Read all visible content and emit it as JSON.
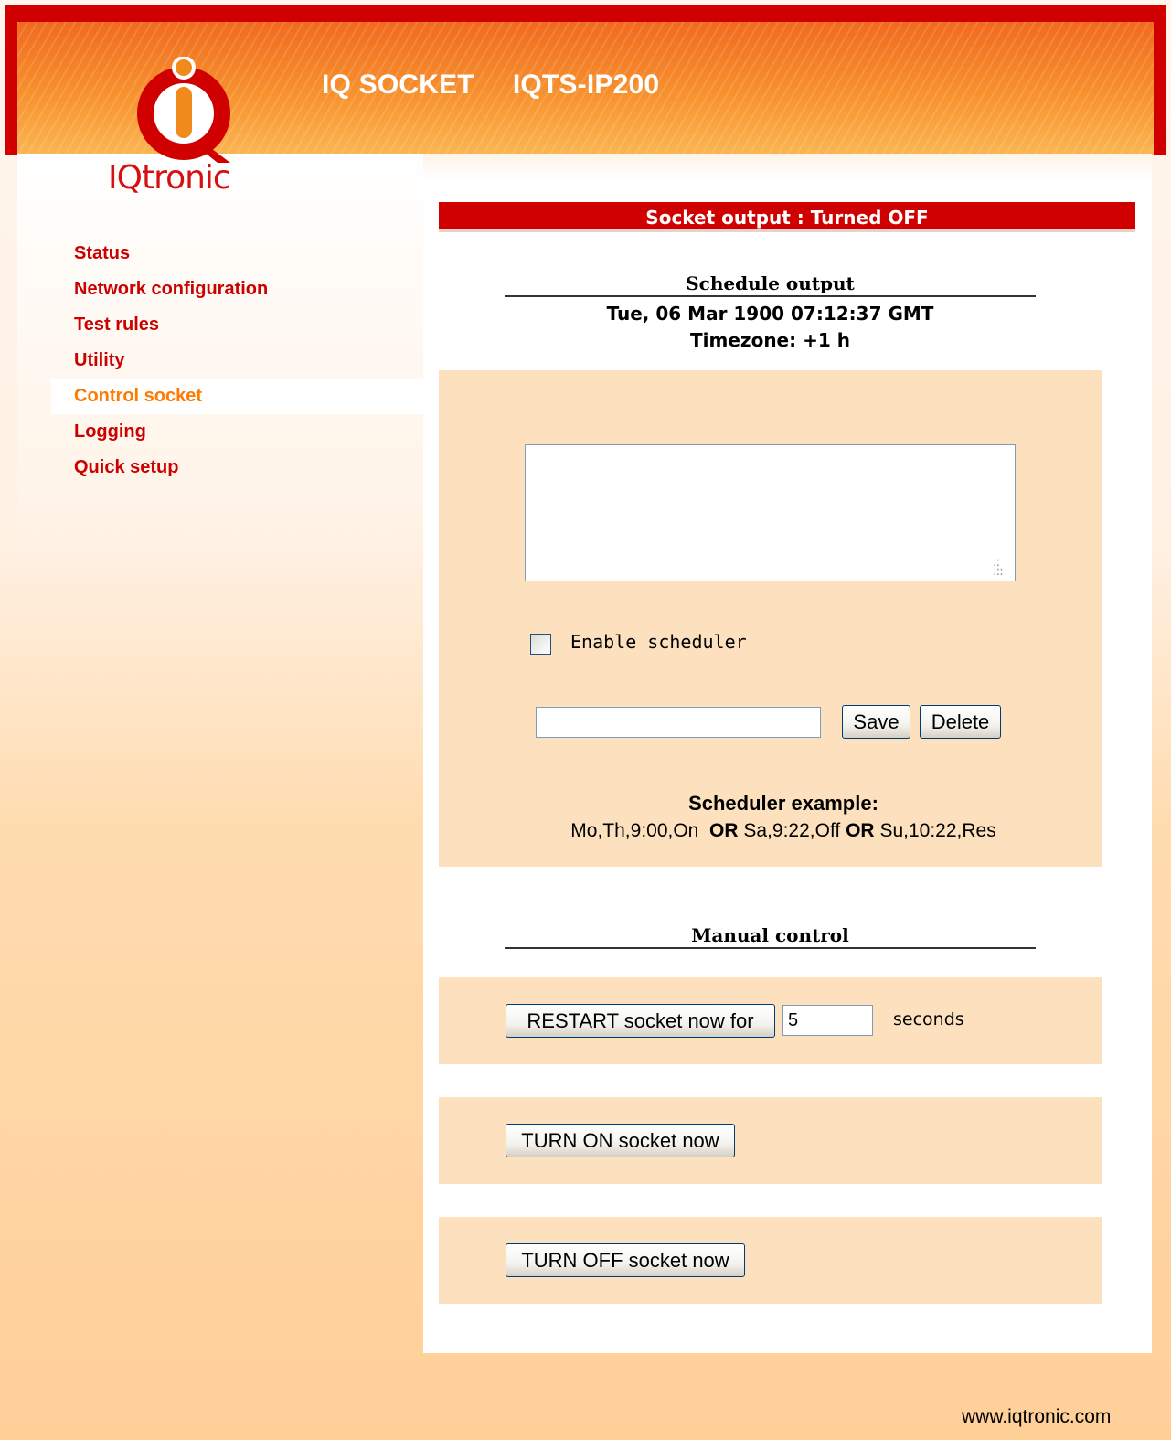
{
  "header": {
    "brand": "IQ SOCKET",
    "model": "IQTS-IP200",
    "logo_text": "IQtronic"
  },
  "nav": {
    "items": [
      {
        "label": "Status"
      },
      {
        "label": "Network configuration"
      },
      {
        "label": "Test rules"
      },
      {
        "label": "Utility"
      },
      {
        "label": "Control socket"
      },
      {
        "label": "Logging"
      },
      {
        "label": "Quick setup"
      }
    ],
    "active": "Control socket"
  },
  "status": {
    "text": "Socket output : Turned OFF"
  },
  "schedule": {
    "title": "Schedule output",
    "datetime": "Tue, 06 Mar 1900 07:12:37 GMT",
    "timezone": "Timezone: +1 h",
    "textarea_value": "",
    "enable_label": "Enable scheduler",
    "enabled": false,
    "rule_input_value": "",
    "save_label": "Save",
    "delete_label": "Delete",
    "example_title": "Scheduler example:",
    "example_part1": "Mo,Th,9:00,On",
    "example_or": "OR",
    "example_part2": "Sa,9:22,Off",
    "example_part3": "Su,10:22,Res"
  },
  "manual": {
    "title": "Manual control",
    "restart_label": "RESTART socket now for",
    "restart_seconds": "5",
    "seconds_label": "seconds",
    "turn_on_label": "TURN ON socket now",
    "turn_off_label": "TURN OFF socket now"
  },
  "footer": {
    "url": "www.iqtronic.com"
  },
  "colors": {
    "brand_red": "#d10000",
    "nav_red": "#cc0000",
    "nav_active": "#ff7a00",
    "panel_peach": "#fde0bd"
  }
}
